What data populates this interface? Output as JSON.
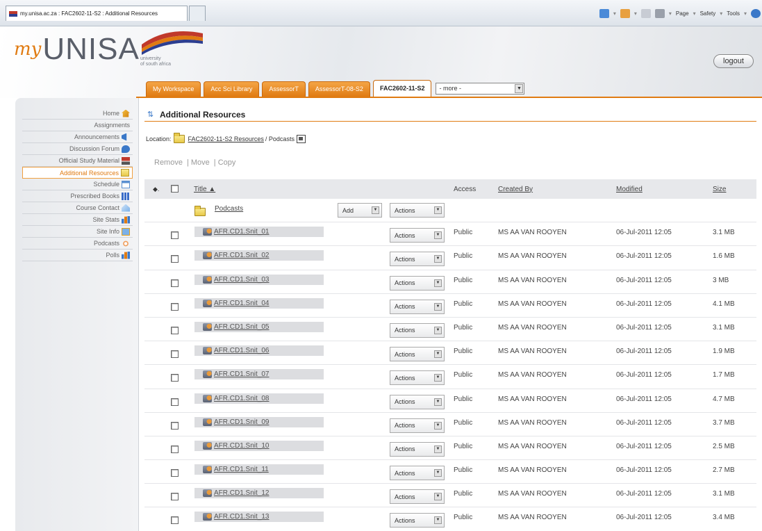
{
  "browser": {
    "tab_title": "my.unisa.ac.za : FAC2602-11-S2 : Additional Resources",
    "commands": [
      "Page",
      "Safety",
      "Tools"
    ]
  },
  "header": {
    "logo_my": "my",
    "logo_unisa": "UNISA",
    "logo_caption_1": "university",
    "logo_caption_2": "of south africa",
    "logout_label": "logout"
  },
  "tabs": [
    {
      "label": "My Workspace",
      "active": false
    },
    {
      "label": "Acc Sci Library",
      "active": false
    },
    {
      "label": "AssessorT",
      "active": false
    },
    {
      "label": "AssessorT-08-S2",
      "active": false
    },
    {
      "label": "FAC2602-11-S2",
      "active": true
    }
  ],
  "more_select": "- more -",
  "left_nav": [
    {
      "label": "Home",
      "icon": "home-icon",
      "color": "#e0a020"
    },
    {
      "label": "Assignments",
      "icon": "",
      "color": ""
    },
    {
      "label": "Announcements",
      "icon": "announcements-icon",
      "color": "#3a78c8"
    },
    {
      "label": "Discussion Forum",
      "icon": "discussion-icon",
      "color": "#3a78c8"
    },
    {
      "label": "Official Study Material",
      "icon": "study-material-icon",
      "color": "#c0392b"
    },
    {
      "label": "Additional Resources",
      "icon": "folder-icon",
      "color": "#e8c94a",
      "selected": true
    },
    {
      "label": "Schedule",
      "icon": "calendar-icon",
      "color": "#5a8fd0"
    },
    {
      "label": "Prescribed Books",
      "icon": "books-icon",
      "color": "#3a6cc8"
    },
    {
      "label": "Course Contact",
      "icon": "contact-icon",
      "color": "#7ab0e8"
    },
    {
      "label": "Site Stats",
      "icon": "stats-icon",
      "color": "#3a78c8"
    },
    {
      "label": "Site Info",
      "icon": "info-icon",
      "color": "#e0a020"
    },
    {
      "label": "Podcasts",
      "icon": "podcast-icon",
      "color": "#f0a060"
    },
    {
      "label": "Polls",
      "icon": "polls-icon",
      "color": "#3a78c8"
    }
  ],
  "main": {
    "title": "Additional Resources",
    "location_label": "Location:",
    "location_link": "FAC2602-11-S2 Resources",
    "location_rest": "/ Podcasts",
    "action_remove": "Remove",
    "action_move": "| Move",
    "action_copy": "| Copy",
    "table": {
      "headers": {
        "title": "Title",
        "title_sort": "▲",
        "access": "Access",
        "created_by": "Created By",
        "modified": "Modified",
        "size": "Size"
      },
      "folder": {
        "name": "Podcasts",
        "add_label": "Add",
        "actions_label": "Actions"
      },
      "rows": [
        {
          "name": "AFR.CD1.Snit_01",
          "actions": "Actions",
          "access": "Public",
          "created_by": "MS AA VAN ROOYEN",
          "modified": "06-Jul-2011 12:05",
          "size": "3.1 MB"
        },
        {
          "name": "AFR.CD1.Snit_02",
          "actions": "Actions",
          "access": "Public",
          "created_by": "MS AA VAN ROOYEN",
          "modified": "06-Jul-2011 12:05",
          "size": "1.6 MB"
        },
        {
          "name": "AFR.CD1.Snit_03",
          "actions": "Actions",
          "access": "Public",
          "created_by": "MS AA VAN ROOYEN",
          "modified": "06-Jul-2011 12:05",
          "size": "3 MB"
        },
        {
          "name": "AFR.CD1.Snit_04",
          "actions": "Actions",
          "access": "Public",
          "created_by": "MS AA VAN ROOYEN",
          "modified": "06-Jul-2011 12:05",
          "size": "4.1 MB"
        },
        {
          "name": "AFR.CD1.Snit_05",
          "actions": "Actions",
          "access": "Public",
          "created_by": "MS AA VAN ROOYEN",
          "modified": "06-Jul-2011 12:05",
          "size": "3.1 MB"
        },
        {
          "name": "AFR.CD1.Snit_06",
          "actions": "Actions",
          "access": "Public",
          "created_by": "MS AA VAN ROOYEN",
          "modified": "06-Jul-2011 12:05",
          "size": "1.9 MB"
        },
        {
          "name": "AFR.CD1.Snit_07",
          "actions": "Actions",
          "access": "Public",
          "created_by": "MS AA VAN ROOYEN",
          "modified": "06-Jul-2011 12:05",
          "size": "1.7 MB"
        },
        {
          "name": "AFR.CD1.Snit_08",
          "actions": "Actions",
          "access": "Public",
          "created_by": "MS AA VAN ROOYEN",
          "modified": "06-Jul-2011 12:05",
          "size": "4.7 MB"
        },
        {
          "name": "AFR.CD1.Snit_09",
          "actions": "Actions",
          "access": "Public",
          "created_by": "MS AA VAN ROOYEN",
          "modified": "06-Jul-2011 12:05",
          "size": "3.7 MB"
        },
        {
          "name": "AFR.CD1.Snit_10",
          "actions": "Actions",
          "access": "Public",
          "created_by": "MS AA VAN ROOYEN",
          "modified": "06-Jul-2011 12:05",
          "size": "2.5 MB"
        },
        {
          "name": "AFR.CD1.Snit_11",
          "actions": "Actions",
          "access": "Public",
          "created_by": "MS AA VAN ROOYEN",
          "modified": "06-Jul-2011 12:05",
          "size": "2.7 MB"
        },
        {
          "name": "AFR.CD1.Snit_12",
          "actions": "Actions",
          "access": "Public",
          "created_by": "MS AA VAN ROOYEN",
          "modified": "06-Jul-2011 12:05",
          "size": "3.1 MB"
        },
        {
          "name": "AFR.CD1.Snit_13",
          "actions": "Actions",
          "access": "Public",
          "created_by": "MS AA VAN ROOYEN",
          "modified": "06-Jul-2011 12:05",
          "size": "3.4 MB"
        }
      ]
    }
  },
  "colors": {
    "accent": "#e07b12",
    "nav_bg": "#e8eaed",
    "table_header": "#e7e8eb"
  }
}
